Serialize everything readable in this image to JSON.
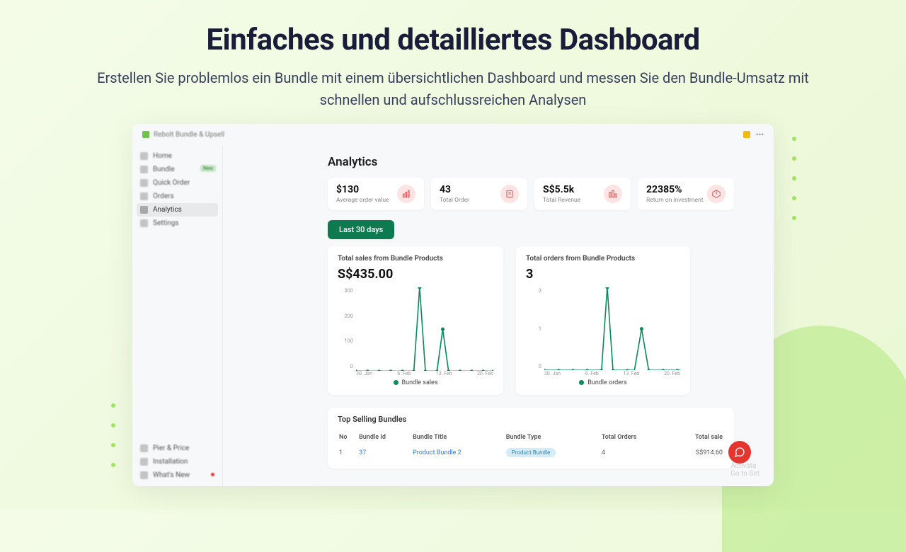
{
  "hero": {
    "title": "Einfaches und detailliertes Dashboard",
    "subtitle": "Erstellen Sie problemlos ein Bundle mit einem übersichtlichen Dashboard und messen Sie den Bundle-Umsatz mit schnellen und aufschlussreichen Analysen"
  },
  "app_title": "Rebolt Bundle & Upsell",
  "sidebar": {
    "items": [
      "Home",
      "Bundle",
      "Quick Order",
      "Orders",
      "Analytics",
      "Settings"
    ],
    "new_label": "New",
    "bottom": [
      "Pier & Price",
      "Installation",
      "What's New"
    ]
  },
  "panel_title": "Analytics",
  "stats": [
    {
      "value": "$130",
      "label": "Average order value"
    },
    {
      "value": "43",
      "label": "Total Order"
    },
    {
      "value": "S$5.5k",
      "label": "Total Revenue"
    },
    {
      "value": "22385%",
      "label": "Return on investment"
    }
  ],
  "range_pill": "Last 30 days",
  "chart1": {
    "title": "Total sales from Bundle Products",
    "big": "S$435.00",
    "legend": "Bundle sales"
  },
  "chart2": {
    "title": "Total orders from Bundle Products",
    "big": "3",
    "legend": "Bundle orders"
  },
  "chart_data": [
    {
      "type": "line",
      "title": "Total sales from Bundle Products",
      "xlabel": "",
      "ylabel": "",
      "ylim": [
        0,
        300
      ],
      "categories": [
        "30. Jan",
        "6. Feb",
        "13. Feb",
        "20. Feb"
      ],
      "series": [
        {
          "name": "Bundle sales",
          "values_sparse": {
            "30. Jan": 0,
            "6. Feb": 300,
            "13. Feb": 150,
            "20. Feb": 0
          },
          "total": "S$435.00"
        }
      ]
    },
    {
      "type": "line",
      "title": "Total orders from Bundle Products",
      "xlabel": "",
      "ylabel": "",
      "ylim": [
        0,
        2
      ],
      "categories": [
        "30. Jan",
        "6. Feb",
        "13. Feb",
        "20. Feb"
      ],
      "series": [
        {
          "name": "Bundle orders",
          "values_sparse": {
            "30. Jan": 0,
            "6. Feb": 2,
            "13. Feb": 1,
            "20. Feb": 0
          },
          "total": 3
        }
      ]
    }
  ],
  "chart_ticks": {
    "y1": [
      "300",
      "200",
      "100",
      "0"
    ],
    "y2": [
      "2",
      "1",
      "0"
    ],
    "x": [
      "30. Jan",
      "6. Feb",
      "13. Feb",
      "20. Feb"
    ]
  },
  "table": {
    "title": "Top Selling Bundles",
    "headers": [
      "No",
      "Bundle Id",
      "Bundle Title",
      "Bundle Type",
      "Total Orders",
      "Total sale"
    ],
    "row": {
      "no": "1",
      "id": "37",
      "title": "Product Bundle 2",
      "type": "Product Bundle",
      "orders": "4",
      "sale": "S$914.60"
    }
  },
  "watermark": {
    "l1": "Activate",
    "l2": "Go to Set"
  }
}
